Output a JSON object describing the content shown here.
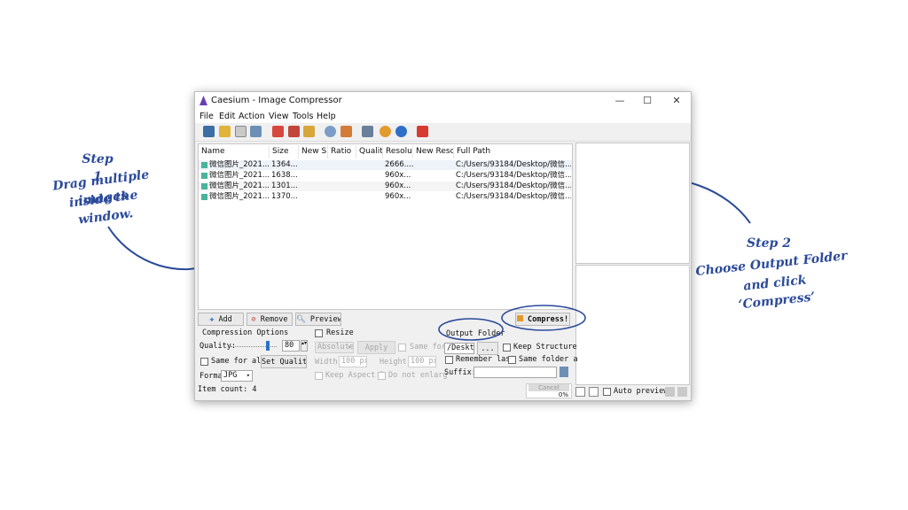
{
  "annotations": {
    "step1": {
      "title": "Step 1",
      "line1": "Drag multiple images",
      "line2": "inside the window."
    },
    "step2": {
      "title": "Step 2",
      "line1": "Choose Output Folder",
      "line2": "and click ‘Compress’"
    }
  },
  "window": {
    "title": "Caesium - Image Compressor",
    "controls": {
      "minimize": "—",
      "maximize": "☐",
      "close": "✕"
    }
  },
  "menu": [
    "File",
    "Edit",
    "Action",
    "View",
    "Tools",
    "Help"
  ],
  "toolbar_icons": [
    "save-icon",
    "open-folder-icon",
    "copy-icon",
    "paste-icon",
    "remove-list-icon",
    "trash-icon",
    "clear-broom-icon",
    "search-icon",
    "preview-image-icon",
    "tools-icon",
    "settings-gear-icon",
    "info-icon",
    "power-icon"
  ],
  "table": {
    "columns": [
      "Name",
      "Size",
      "New Si",
      "Ratio",
      "Qualit",
      "Resolu",
      "New Resol",
      "Full Path"
    ],
    "rows": [
      {
        "name": "微信图片_2021...",
        "size": "1364....",
        "resolution": "2666....",
        "path": "C:/Users/93184/Desktop/微信..."
      },
      {
        "name": "微信图片_2021...",
        "size": "1638....",
        "resolution": "960x...",
        "path": "C:/Users/93184/Desktop/微信..."
      },
      {
        "name": "微信图片_2021...",
        "size": "1301....",
        "resolution": "960x...",
        "path": "C:/Users/93184/Desktop/微信..."
      },
      {
        "name": "微信图片_2021...",
        "size": "1370....",
        "resolution": "960x...",
        "path": "C:/Users/93184/Desktop/微信..."
      }
    ]
  },
  "actions": {
    "add": "Add",
    "remove": "Remove",
    "preview": "Preview",
    "compress": "Compress!"
  },
  "compression": {
    "title": "Compression Options",
    "quality_label": "Quality:",
    "quality_value": "80",
    "quality_level": 0.8,
    "same_for_all": "Same for all",
    "set_quality": "Set Quality",
    "format_label": "Forma",
    "format_value": "JPG"
  },
  "resize": {
    "label": "Resize",
    "mode": "Absolute",
    "apply": "Apply",
    "same_for": "Same for",
    "width_label": "Width:",
    "width_value": "100 px",
    "height_label": "Height:",
    "height_value": "100 px",
    "keep_aspect": "Keep Aspect R",
    "no_enlarge": "Do not enlarg"
  },
  "output": {
    "title": "Output Folder",
    "path": "/Desktop",
    "browse": "...",
    "keep_structure": "Keep Structure",
    "remember_last": "Remember last",
    "same_folder": "Same folder a",
    "suffix_label": "Suffix:"
  },
  "status": {
    "item_count": "Item count: 4",
    "cancel": "Cancel",
    "progress": "0%",
    "auto_preview": "Auto preview"
  },
  "colors": {
    "annotation": "#2b4a9a",
    "accent": "#3c6fd1"
  }
}
